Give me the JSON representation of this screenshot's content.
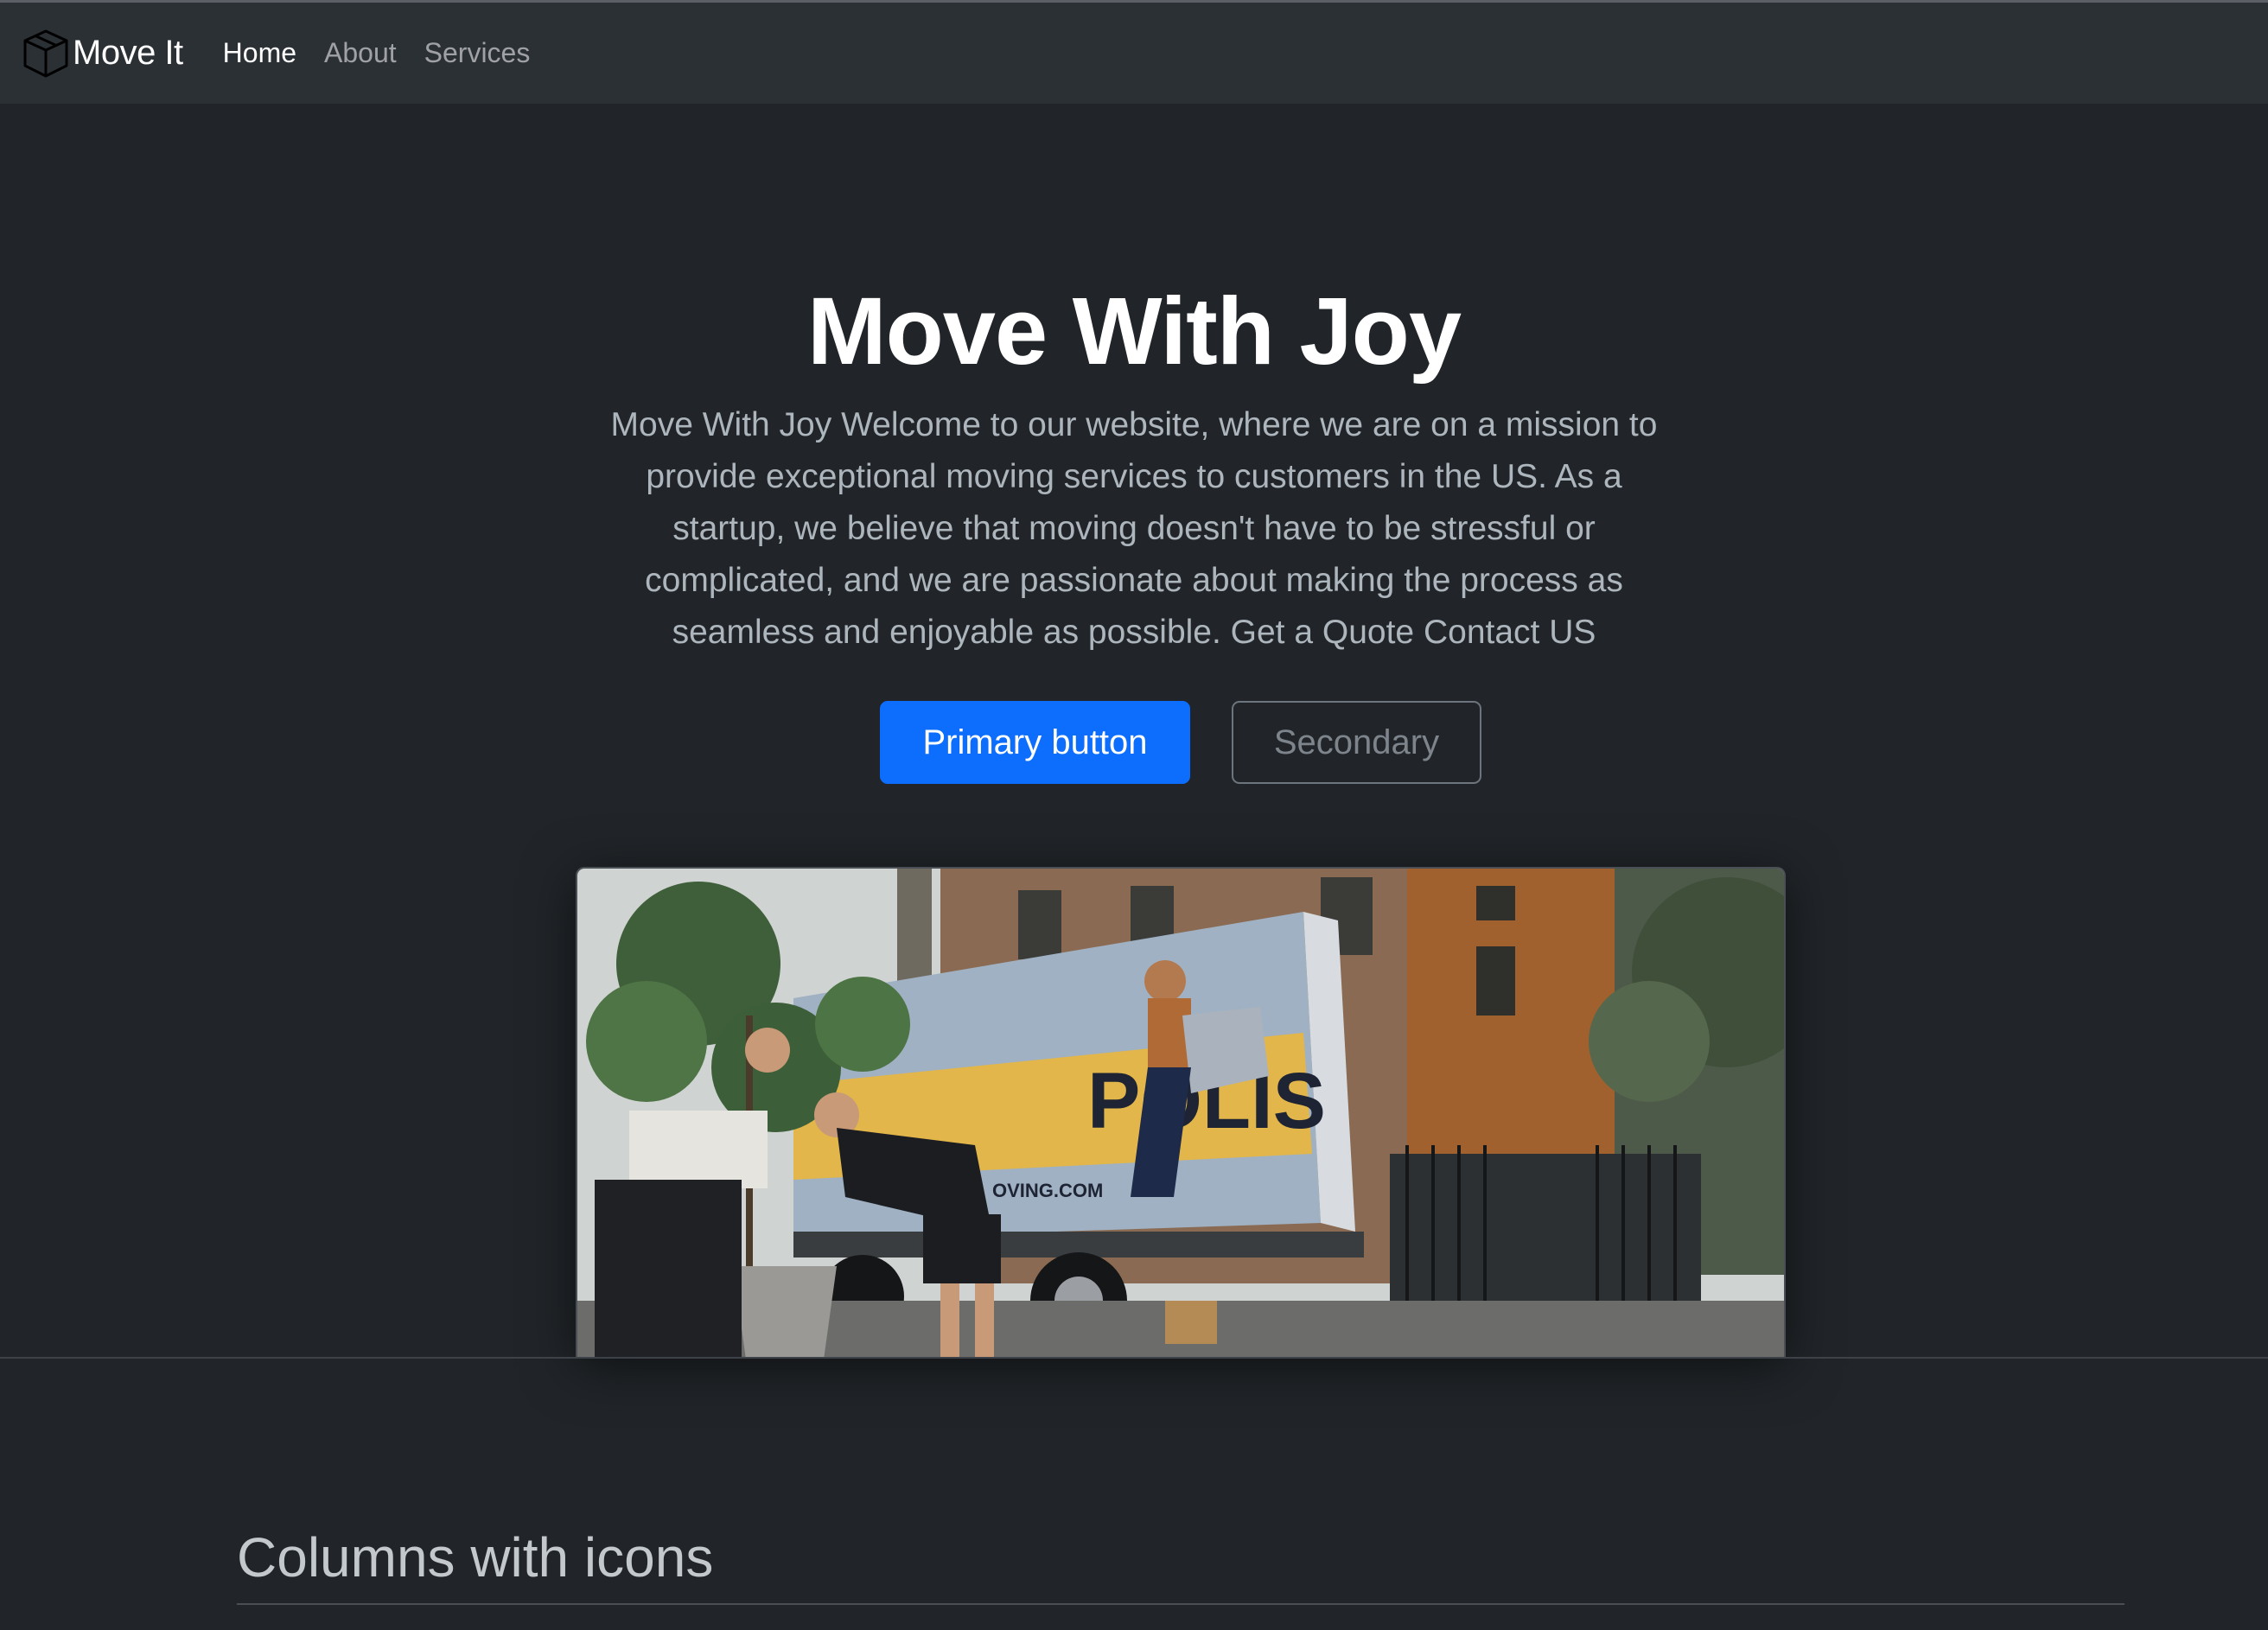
{
  "navbar": {
    "brand": {
      "label": "Move It",
      "icon": "box-icon"
    },
    "links": [
      {
        "label": "Home",
        "active": true
      },
      {
        "label": "About",
        "active": false
      },
      {
        "label": "Services",
        "active": false
      }
    ]
  },
  "hero": {
    "title": "Move With Joy",
    "description": "Move With Joy Welcome to our website, where we are on a mission to provide exceptional moving services to customers in the US. As a startup, we believe that moving doesn't have to be stressful or complicated, and we are passionate about making the process as seamless and enjoyable as possible. Get a Quote Contact US",
    "primary_button": "Primary button",
    "secondary_button": "Secondary",
    "image": {
      "subject": "movers-loading-truck-photo",
      "truck_text_large": "POLIS",
      "truck_text_small": "OVING.COM"
    }
  },
  "features": {
    "title": "Columns with icons"
  },
  "colors": {
    "background": "#212529",
    "navbar": "#2b3035",
    "primary": "#0d6efd",
    "secondary_border": "#6c757d",
    "text_muted": "#adb5bd"
  }
}
